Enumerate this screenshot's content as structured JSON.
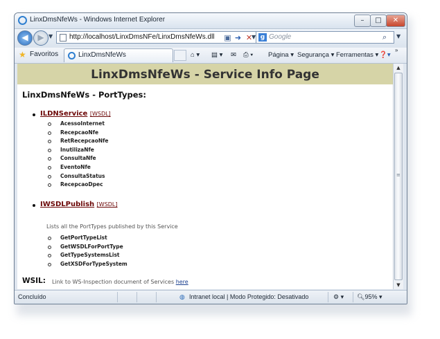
{
  "window": {
    "title": "LinxDmsNfeWs - Windows Internet Explorer"
  },
  "address_bar": {
    "url": "http://localhost/LinxDmsNFe/LinxDmsNfeWs.dll"
  },
  "search": {
    "placeholder": "Google"
  },
  "favorites": {
    "label": "Favoritos"
  },
  "tab": {
    "label": "LinxDmsNfeWs"
  },
  "command_bar": {
    "page": "Página",
    "security": "Segurança",
    "tools": "Ferramentas"
  },
  "page": {
    "title": "LinxDmsNfeWs - Service Info Page",
    "porttypes_heading": "LinxDmsNfeWs - PortTypes:",
    "services": [
      {
        "name": "ILDNService",
        "wsdl_label": "[WSDL]",
        "description": "",
        "operations": [
          "AcessoInternet",
          "RecepcaoNfe",
          "RetRecepcaoNfe",
          "InutilizaNfe",
          "ConsultaNfe",
          "EventoNfe",
          "ConsultaStatus",
          "RecepcaoDpec"
        ]
      },
      {
        "name": "IWSDLPublish",
        "wsdl_label": "[WSDL]",
        "description": "Lists all the PortTypes published by this Service",
        "operations": [
          "GetPortTypeList",
          "GetWSDLForPortType",
          "GetTypeSystemsList",
          "GetXSDForTypeSystem"
        ]
      }
    ],
    "wsil": {
      "label": "WSIL:",
      "text": "Link to WS-Inspection document of Services",
      "link": "here"
    }
  },
  "status": {
    "left": "Concluído",
    "zone": "Intranet local | Modo Protegido: Desativado",
    "zoom": "95%"
  }
}
